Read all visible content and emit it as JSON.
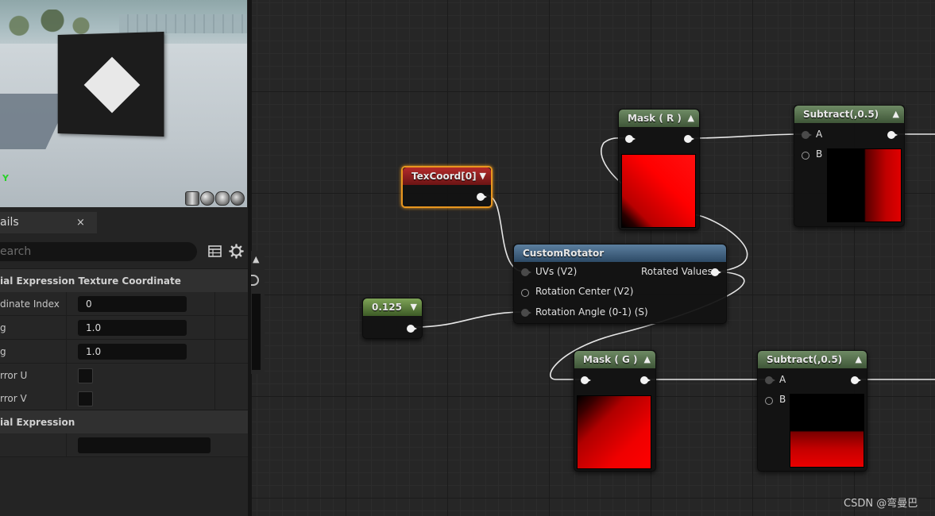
{
  "viewport": {
    "axis_label": "Y",
    "preview_shapes": [
      "cylinder-icon",
      "sphere-icon",
      "plane-icon",
      "cube-icon",
      "teapot-icon"
    ]
  },
  "details": {
    "tab_label": "ails",
    "close_label": "×",
    "search_placeholder": "earch",
    "section1": "ial Expression Texture Coordinate",
    "properties": [
      {
        "name": "dinate Index",
        "value": "0"
      },
      {
        "name": "g",
        "value": "1.0"
      },
      {
        "name": "g",
        "value": "1.0"
      },
      {
        "name": "rror U",
        "checked": false
      },
      {
        "name": "rror V",
        "checked": false
      }
    ],
    "section2": "ial Expression",
    "extra_value": ""
  },
  "graph": {
    "texcoord": {
      "title": "TexCoord[0]"
    },
    "constant": {
      "title": "0.125"
    },
    "rotator": {
      "title": "CustomRotator",
      "inputs": [
        "UVs (V2)",
        "Rotation Center (V2)",
        "Rotation Angle (0-1) (S)"
      ],
      "output": "Rotated Values"
    },
    "mask_r": {
      "title": "Mask ( R )"
    },
    "mask_g": {
      "title": "Mask ( G )"
    },
    "subtract_top": {
      "title": "Subtract(,0.5)",
      "inputs": [
        "A",
        "B"
      ]
    },
    "subtract_bottom": {
      "title": "Subtract(,0.5)",
      "inputs": [
        "A",
        "B"
      ]
    }
  },
  "colors": {
    "texcoord_header": "#b32b2b",
    "rotator_header": "#5c7f9f",
    "mask_header": "#6e8a64",
    "selection_outline": "#e8961f",
    "preview_red": "#ff0000"
  },
  "watermark": "CSDN @弯曼巴"
}
